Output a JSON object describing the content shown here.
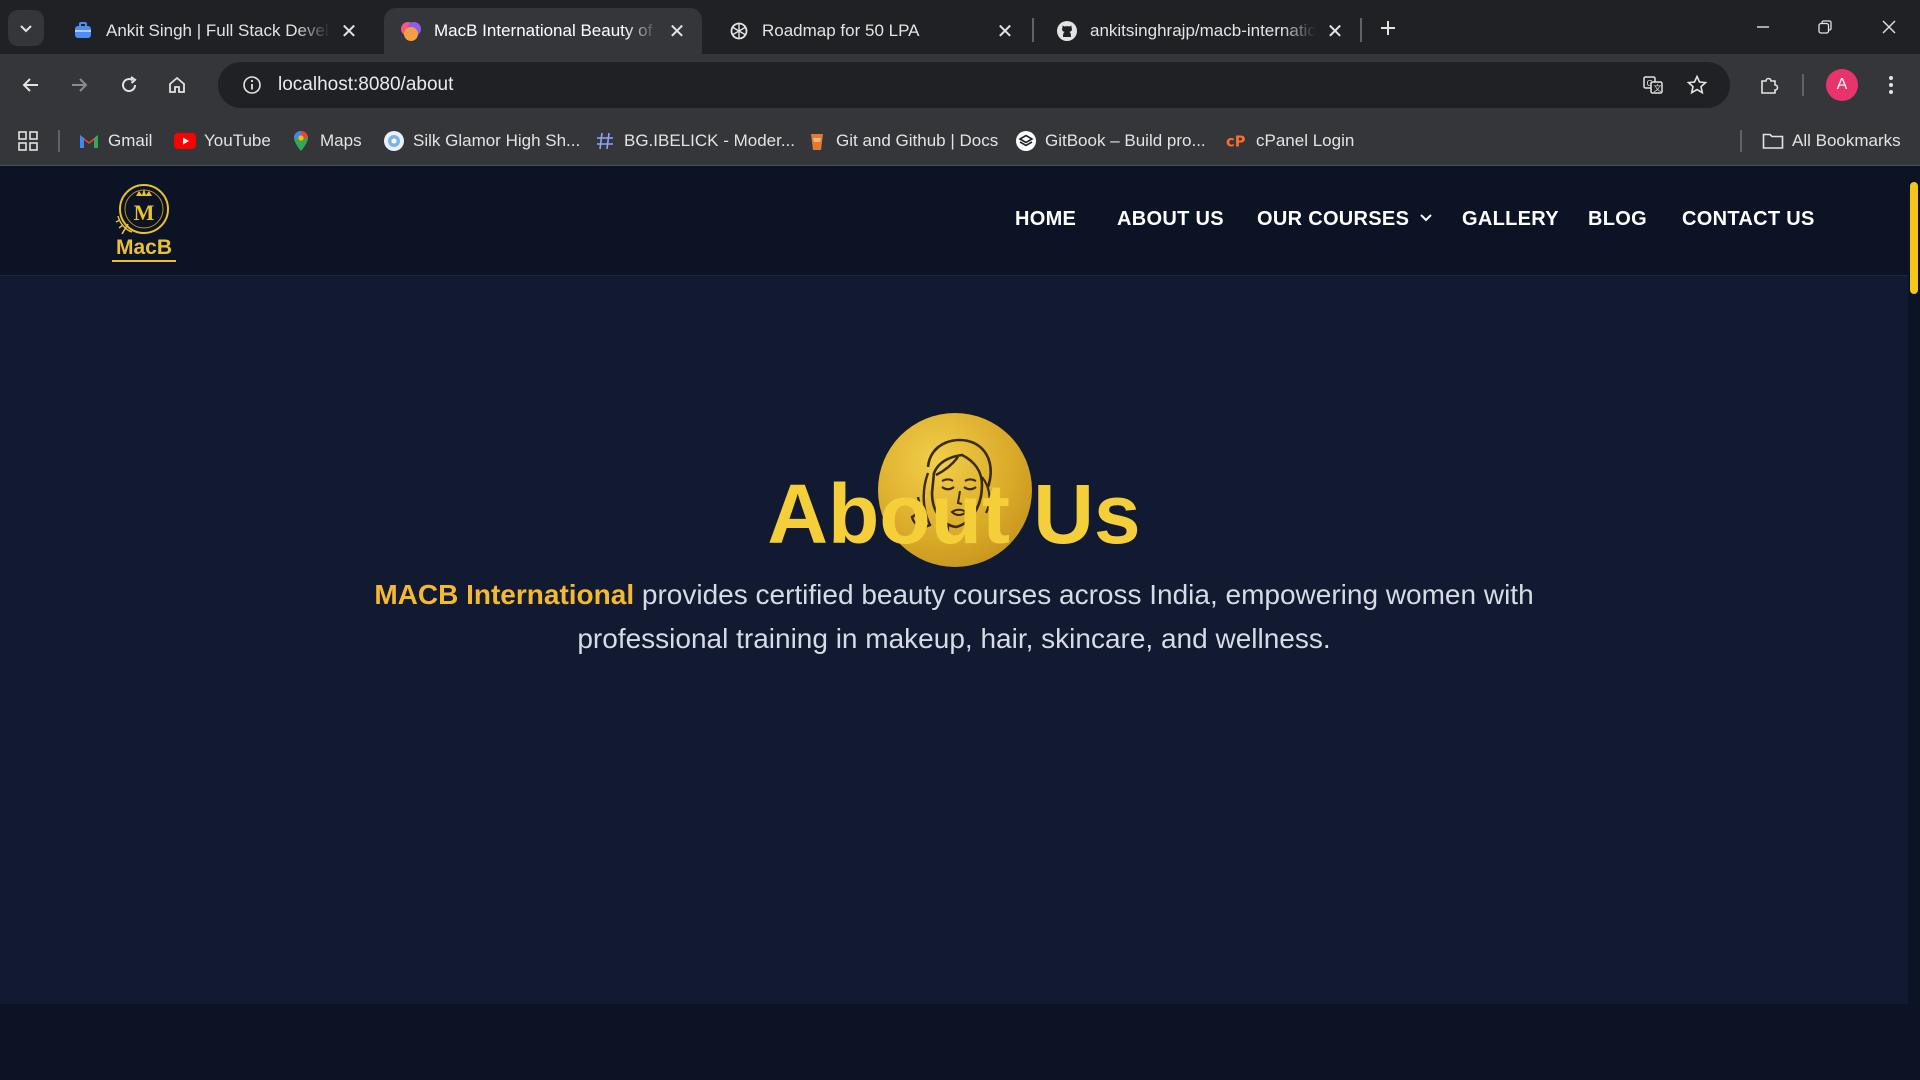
{
  "browser": {
    "tabs": [
      {
        "title": "Ankit Singh | Full Stack Developer",
        "active": false
      },
      {
        "title": "MacB International Beauty of School",
        "active": true
      },
      {
        "title": "Roadmap for 50 LPA",
        "active": false
      },
      {
        "title": "ankitsinghrajp/macb-international",
        "active": false
      }
    ],
    "url": "localhost:8080/about",
    "avatar_letter": "A",
    "bookmarks": [
      {
        "label": "Gmail",
        "icon": "gmail-icon"
      },
      {
        "label": "YouTube",
        "icon": "youtube-icon"
      },
      {
        "label": "Maps",
        "icon": "maps-icon"
      },
      {
        "label": "Silk Glamor High Sh...",
        "icon": "silk-glamor-icon"
      },
      {
        "label": "BG.IBELICK - Moder...",
        "icon": "hash-icon"
      },
      {
        "label": "Git and Github | Docs",
        "icon": "git-docs-icon"
      },
      {
        "label": "GitBook – Build pro...",
        "icon": "gitbook-icon"
      },
      {
        "label": "cPanel Login",
        "icon": "cpanel-icon"
      }
    ],
    "all_bookmarks": "All Bookmarks"
  },
  "site": {
    "logo_text": "MacB",
    "nav": {
      "home": "HOME",
      "about": "ABOUT US",
      "courses": "OUR COURSES",
      "gallery": "GALLERY",
      "blog": "BLOG",
      "contact": "CONTACT US"
    },
    "hero": {
      "title": "About Us",
      "highlight": "MACB International",
      "description": " provides certified beauty courses across India, empowering women with professional training in makeup, hair, skincare, and wellness."
    }
  },
  "colors": {
    "accent_gold": "#f5cf3a",
    "highlight_orange": "#f5b930",
    "page_bg": "#111a30",
    "nav_bg": "#0b1324"
  }
}
